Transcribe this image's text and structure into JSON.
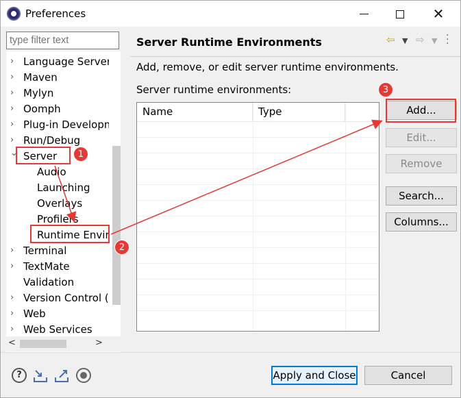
{
  "window": {
    "title": "Preferences",
    "icon": "eclipse-icon"
  },
  "filter": {
    "placeholder": "type filter text"
  },
  "tree": {
    "items": [
      {
        "label": "Language Server",
        "expandable": true,
        "level": 0
      },
      {
        "label": "Maven",
        "expandable": true,
        "level": 0
      },
      {
        "label": "Mylyn",
        "expandable": true,
        "level": 0
      },
      {
        "label": "Oomph",
        "expandable": true,
        "level": 0
      },
      {
        "label": "Plug-in Developm",
        "expandable": true,
        "level": 0
      },
      {
        "label": "Run/Debug",
        "expandable": true,
        "level": 0
      },
      {
        "label": "Server",
        "expandable": true,
        "expanded": true,
        "level": 0
      },
      {
        "label": "Audio",
        "expandable": false,
        "level": 1
      },
      {
        "label": "Launching",
        "expandable": false,
        "level": 1
      },
      {
        "label": "Overlays",
        "expandable": false,
        "level": 1
      },
      {
        "label": "Profilers",
        "expandable": false,
        "level": 1
      },
      {
        "label": "Runtime Envir",
        "expandable": false,
        "level": 1,
        "selected": true
      },
      {
        "label": "Terminal",
        "expandable": true,
        "level": 0
      },
      {
        "label": "TextMate",
        "expandable": true,
        "level": 0
      },
      {
        "label": "Validation",
        "expandable": false,
        "level": 0
      },
      {
        "label": "Version Control (",
        "expandable": true,
        "level": 0
      },
      {
        "label": "Web",
        "expandable": true,
        "level": 0
      },
      {
        "label": "Web Services",
        "expandable": true,
        "level": 0
      }
    ]
  },
  "page": {
    "title": "Server Runtime Environments",
    "description": "Add, remove, or edit server runtime environments.",
    "list_label": "Server runtime environments:",
    "columns": [
      "Name",
      "Type"
    ]
  },
  "buttons": {
    "add": "Add...",
    "edit": "Edit...",
    "remove": "Remove",
    "search": "Search...",
    "columns": "Columns..."
  },
  "footer": {
    "apply_close": "Apply and Close",
    "cancel": "Cancel"
  },
  "annotations": {
    "badge1": "1",
    "badge2": "2",
    "badge3": "3",
    "color": "#e53935"
  }
}
